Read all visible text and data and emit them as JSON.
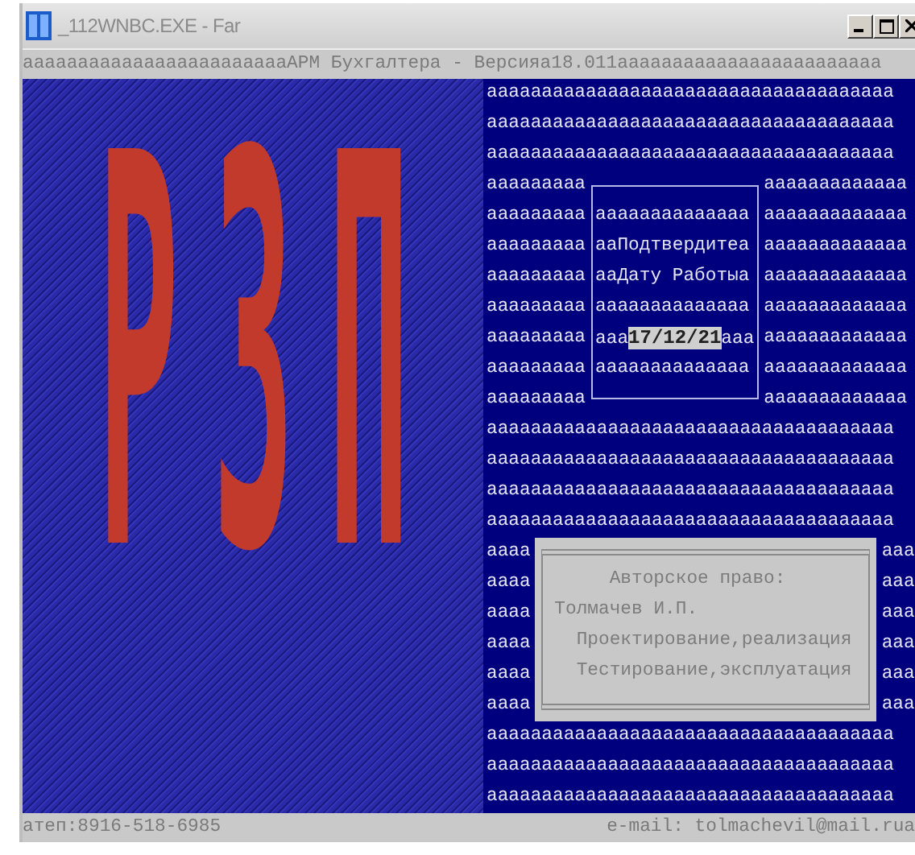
{
  "window": {
    "title": "_112WNBC.EXE - Far"
  },
  "header": "aaaaaaaaaaaaaaaaaaaaaaaaАРМ Бухгалтера - Версияa18.011aaaaaaaaaaaaaaaaaaaaaaaa",
  "logo": "РЗП",
  "screen": {
    "rows_top": [
      "aaaaaaaaaaaaaaaaaaaaaaaaaaaaaaaaaaaaa",
      "aaaaaaaaaaaaaaaaaaaaaaaaaaaaaaaaaaaaa",
      "aaaaaaaaaaaaaaaaaaaaaaaaaaaaaaaaaaaaa"
    ],
    "date_dialog": {
      "side_left": [
        "aaaaaaaaa",
        "aaaaaaaaa",
        "aaaaaaaaa",
        "aaaaaaaaa",
        "aaaaaaaaa",
        "aaaaaaaaa",
        "aaaaaaaaa",
        "aaaaaaaaa"
      ],
      "lines": [
        {
          "kind": "text",
          "text": "aaaaaaaaaaaaaa"
        },
        {
          "kind": "text",
          "text": "aaПодтвердитеa"
        },
        {
          "kind": "text",
          "text": "aaДату Работыa"
        },
        {
          "kind": "text",
          "text": "aaaaaaaaaaaaaa"
        },
        {
          "kind": "field",
          "before": "aaa",
          "value": "17/12/21",
          "after": "aaa"
        },
        {
          "kind": "text",
          "text": "aaaaaaaaaaaaaa"
        }
      ],
      "side_right": [
        "aaaaaaaaaaaaa",
        "aaaaaaaaaaaaa",
        "aaaaaaaaaaaaa",
        "aaaaaaaaaaaaa",
        "aaaaaaaaaaaaa",
        "aaaaaaaaaaaaa",
        "aaaaaaaaaaaaa",
        "aaaaaaaaaaaaa"
      ]
    },
    "rows_middle": [
      "aaaaaaaaaaaaaaaaaaaaaaaaaaaaaaaaaaaaa",
      "aaaaaaaaaaaaaaaaaaaaaaaaaaaaaaaaaaaaa",
      "aaaaaaaaaaaaaaaaaaaaaaaaaaaaaaaaaaaaa",
      "aaaaaaaaaaaaaaaaaaaaaaaaaaaaaaaaaaaaa"
    ],
    "copyright_dialog": {
      "side_left": [
        "aaaa",
        "aaaa",
        "aaaa",
        "aaaa",
        "aaaa",
        "aaaa"
      ],
      "lines": [
        "Авторское право:",
        "Толмачев И.П.",
        "Проектирование,реализация",
        "Тестирование,эксплуатация"
      ],
      "side_right": [
        "aaa",
        "aaa",
        "aaa",
        "aaa",
        "aaa",
        "aaa"
      ]
    },
    "rows_bottom": [
      "aaaaaaaaaaaaaaaaaaaaaaaaaaaaaaaaaaaaa",
      "aaaaaaaaaaaaaaaaaaaaaaaaaaaaaaaaaaaaa",
      "aaaaaaaaaaaaaaaaaaaaaaaaaaaaaaaaaaaaa"
    ]
  },
  "status_bar": {
    "phone": "атеп:8916-518-6985",
    "email": "e-mail: tolmachevil@mail.rua"
  }
}
